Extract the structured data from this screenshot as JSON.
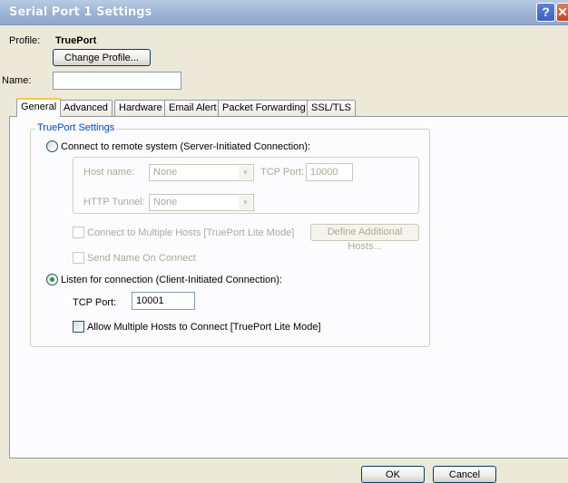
{
  "window": {
    "title": "Serial Port 1 Settings",
    "help_glyph": "?",
    "close_glyph": "✕"
  },
  "profile": {
    "label": "Profile:",
    "value": "TruePort",
    "change_button": "Change Profile..."
  },
  "name": {
    "label": "Name:",
    "value": ""
  },
  "tabs": [
    "General",
    "Advanced",
    "Hardware",
    "Email Alert",
    "Packet Forwarding",
    "SSL/TLS"
  ],
  "active_tab": "General",
  "trueport_settings": {
    "legend": "TruePort Settings",
    "connect_remote": {
      "label": "Connect to remote system (Server-Initiated Connection):",
      "selected": false,
      "host_name_label": "Host name:",
      "host_name_value": "None",
      "tcp_port_label": "TCP Port:",
      "tcp_port_value": "10000",
      "http_tunnel_label": "HTTP Tunnel:",
      "http_tunnel_value": "None",
      "multiple_hosts_label": "Connect to Multiple Hosts [TruePort Lite Mode]",
      "define_hosts_button": "Define Additional Hosts...",
      "send_name_label": "Send Name On Connect"
    },
    "listen": {
      "label": "Listen for connection (Client-Initiated Connection):",
      "selected": true,
      "tcp_port_label": "TCP Port:",
      "tcp_port_value": "10001",
      "allow_multiple_label": "Allow Multiple Hosts to Connect [TruePort Lite Mode]"
    }
  },
  "buttons": {
    "ok": "OK",
    "cancel": "Cancel"
  },
  "colors": {
    "accent": "#0046d5",
    "titlebar": "#9cb3d4",
    "tab_highlight": "#ffc83c",
    "radio_selected": "#21a121"
  }
}
